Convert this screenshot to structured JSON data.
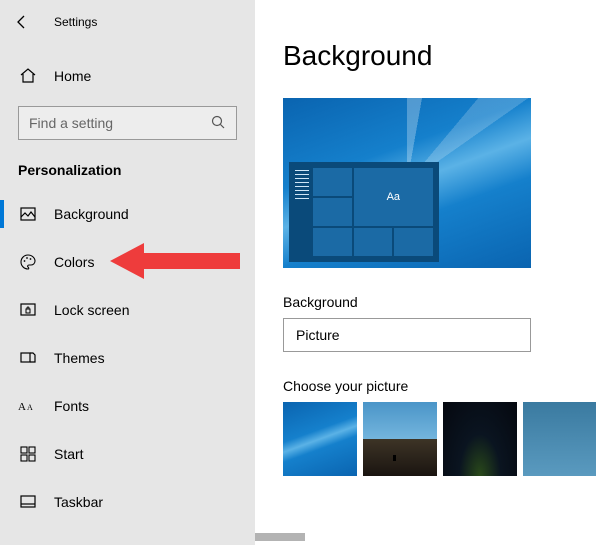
{
  "window": {
    "title": "Settings"
  },
  "home": {
    "label": "Home"
  },
  "search": {
    "placeholder": "Find a setting"
  },
  "section": {
    "label": "Personalization"
  },
  "nav": {
    "items": [
      {
        "label": "Background"
      },
      {
        "label": "Colors"
      },
      {
        "label": "Lock screen"
      },
      {
        "label": "Themes"
      },
      {
        "label": "Fonts"
      },
      {
        "label": "Start"
      },
      {
        "label": "Taskbar"
      }
    ]
  },
  "main": {
    "title": "Background",
    "preview_tile_text": "Aa",
    "dropdown": {
      "label": "Background",
      "value": "Picture"
    },
    "choose": {
      "label": "Choose your picture"
    }
  }
}
